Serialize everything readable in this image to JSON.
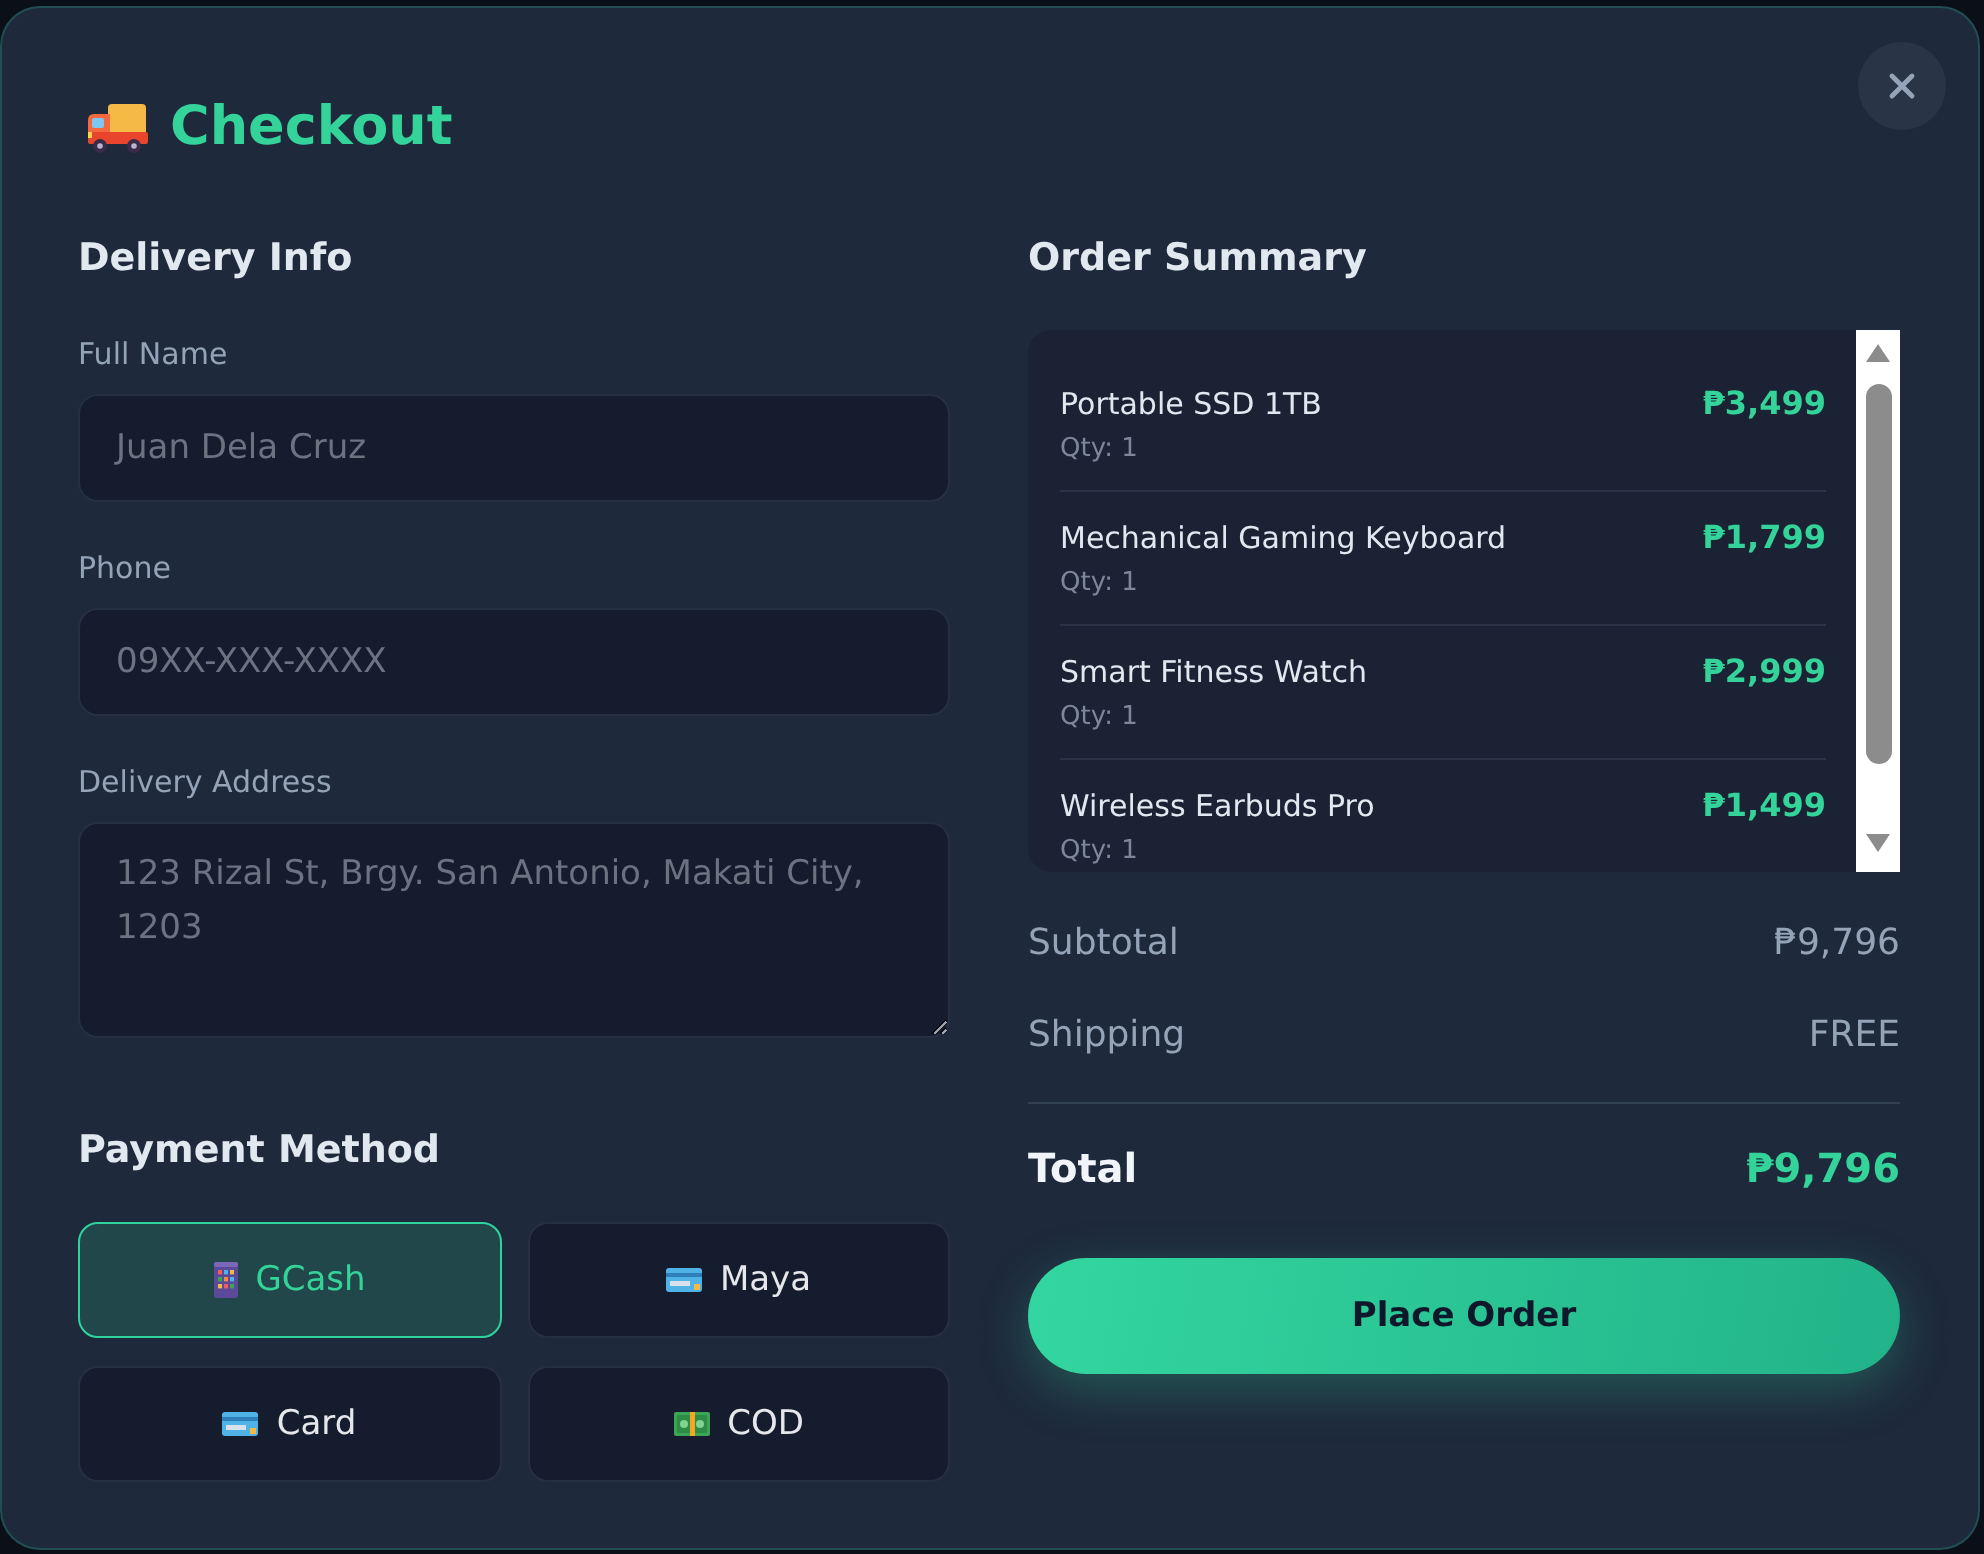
{
  "dialog": {
    "title": "Checkout"
  },
  "delivery_info": {
    "heading": "Delivery Info",
    "fields": [
      {
        "kind": "input",
        "label": "Full Name",
        "placeholder": "Juan Dela Cruz"
      },
      {
        "kind": "input",
        "label": "Phone",
        "placeholder": "09XX-XXX-XXXX"
      },
      {
        "kind": "textarea",
        "label": "Delivery Address",
        "placeholder": "123 Rizal St, Brgy. San Antonio, Makati City, 1203"
      }
    ]
  },
  "payment": {
    "heading": "Payment Method",
    "options": [
      {
        "kind": "mobile",
        "label": "GCash",
        "selected": true
      },
      {
        "kind": "card",
        "label": "Maya",
        "selected": false
      },
      {
        "kind": "card",
        "label": "Card",
        "selected": false
      },
      {
        "kind": "cash",
        "label": "COD",
        "selected": false
      }
    ]
  },
  "order_summary": {
    "heading": "Order Summary",
    "items": [
      {
        "name": "Portable SSD 1TB",
        "qty": "Qty: 1",
        "price": "₱3,499"
      },
      {
        "name": "Mechanical Gaming Keyboard",
        "qty": "Qty: 1",
        "price": "₱1,799"
      },
      {
        "name": "Smart Fitness Watch",
        "qty": "Qty: 1",
        "price": "₱2,999"
      },
      {
        "name": "Wireless Earbuds Pro",
        "qty": "Qty: 1",
        "price": "₱1,499"
      }
    ],
    "totals": [
      {
        "kind": "line",
        "label": "Subtotal",
        "value": "₱9,796"
      },
      {
        "kind": "line",
        "label": "Shipping",
        "value": "FREE"
      },
      {
        "kind": "total",
        "label": "Total",
        "value": "₱9,796"
      }
    ],
    "button": "Place Order"
  }
}
